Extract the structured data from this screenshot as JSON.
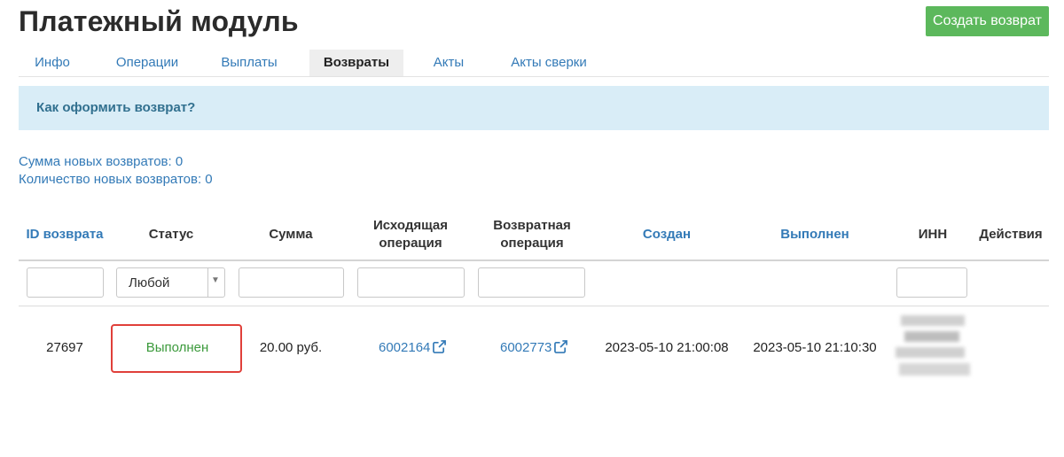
{
  "page": {
    "title": "Платежный модуль",
    "create_button": "Создать возврат"
  },
  "tabs": [
    {
      "label": "Инфо",
      "active": false
    },
    {
      "label": "Операции",
      "active": false
    },
    {
      "label": "Выплаты",
      "active": false
    },
    {
      "label": "Возвраты",
      "active": true
    },
    {
      "label": "Акты",
      "active": false
    },
    {
      "label": "Акты сверки",
      "active": false
    }
  ],
  "info": {
    "link": "Как оформить возврат?"
  },
  "summary": {
    "sum": "Сумма новых возвратов: 0",
    "count": "Количество новых возвратов: 0"
  },
  "table": {
    "headers": {
      "id": "ID возврата",
      "status": "Статус",
      "amount": "Сумма",
      "source_op_1": "Исходящая",
      "source_op_2": "операция",
      "return_op_1": "Возвратная",
      "return_op_2": "операция",
      "created": "Создан",
      "completed": "Выполнен",
      "inn": "ИНН",
      "actions": "Действия"
    },
    "filters": {
      "status_selected": "Любой"
    },
    "rows": [
      {
        "id": "27697",
        "status": "Выполнен",
        "amount": "20.00 руб.",
        "source_op": "6002164",
        "return_op": "6002773",
        "created": "2023-05-10 21:00:08",
        "completed": "2023-05-10 21:10:30"
      }
    ]
  },
  "colors": {
    "link": "#337ab7",
    "success": "#5cb85c",
    "status_done": "#3c9a3c",
    "info_bg": "#d9edf7",
    "highlight": "#e0403a"
  }
}
